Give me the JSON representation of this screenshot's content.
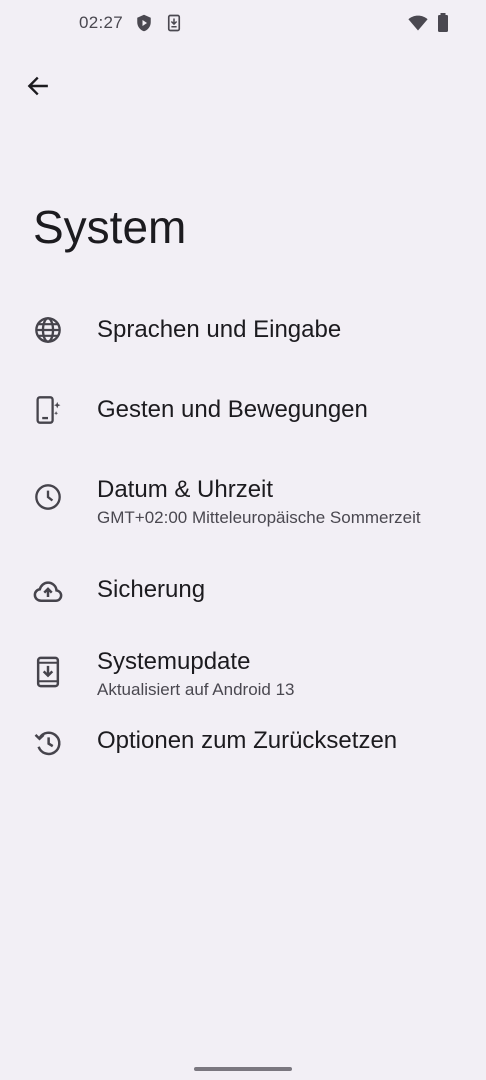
{
  "status_bar": {
    "time": "02:27",
    "icons": [
      "shield-play-icon",
      "download-notification-icon",
      "wifi-icon",
      "battery-icon"
    ]
  },
  "header": {
    "back_icon": "arrow-back-icon"
  },
  "page": {
    "title": "System"
  },
  "settings": {
    "items": [
      {
        "icon": "globe-icon",
        "title": "Sprachen und Eingabe",
        "summary": ""
      },
      {
        "icon": "gestures-phone-icon",
        "title": "Gesten und Bewegungen",
        "summary": ""
      },
      {
        "icon": "clock-icon",
        "title": "Datum & Uhrzeit",
        "summary": "GMT+02:00 Mitteleuropäische Sommerzeit"
      },
      {
        "icon": "cloud-upload-icon",
        "title": "Sicherung",
        "summary": ""
      },
      {
        "icon": "system-update-icon",
        "title": "Systemupdate",
        "summary": "Aktualisiert auf Android 13"
      },
      {
        "icon": "history-reset-icon",
        "title": "Optionen zum Zurücksetzen",
        "summary": ""
      }
    ]
  },
  "colors": {
    "background": "#f2eff5",
    "text_primary": "#1c1b1f",
    "text_secondary": "#4a4850",
    "icon": "#46444c"
  }
}
